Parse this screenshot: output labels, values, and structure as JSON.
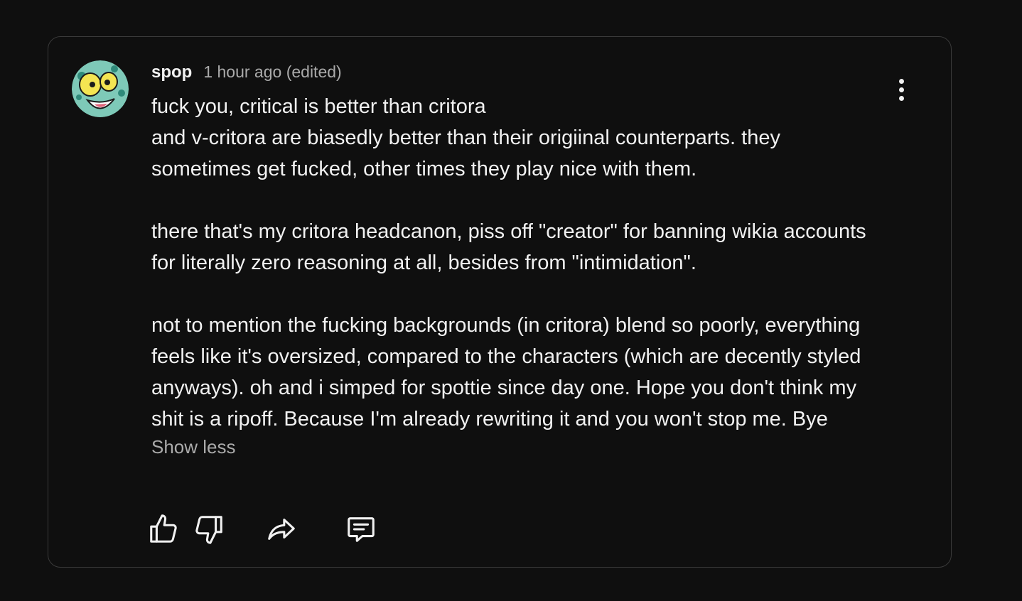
{
  "comment": {
    "author": "spop",
    "timestamp": "1 hour ago (edited)",
    "body": [
      "fuck you, critical is better than critora\nand v-critora are biasedly better than their origiinal counterparts. they sometimes get fucked, other times they play nice with them.",
      "there that's my critora headcanon, piss off \"creator\" for banning wikia accounts for literally zero reasoning at all, besides from \"intimidation\".",
      "not to mention the fucking backgrounds (in critora) blend so poorly, everything feels like it's oversized, compared to the characters (which are decently styled anyways). oh and i simped for spottie since day one. Hope you don't think my shit is a ripoff. Because I'm already rewriting it and you won't stop me. Bye"
    ],
    "show_less_label": "Show less",
    "icons": {
      "avatar": "avatar-image",
      "more": "more-vertical-icon",
      "like": "thumbs-up-icon",
      "dislike": "thumbs-down-icon",
      "share": "share-icon",
      "reply": "reply-comment-icon"
    }
  },
  "colors": {
    "background": "#0f0f0f",
    "border": "#3a3a3a",
    "text_primary": "#f1f1f1",
    "text_secondary": "#aaaaaa"
  }
}
